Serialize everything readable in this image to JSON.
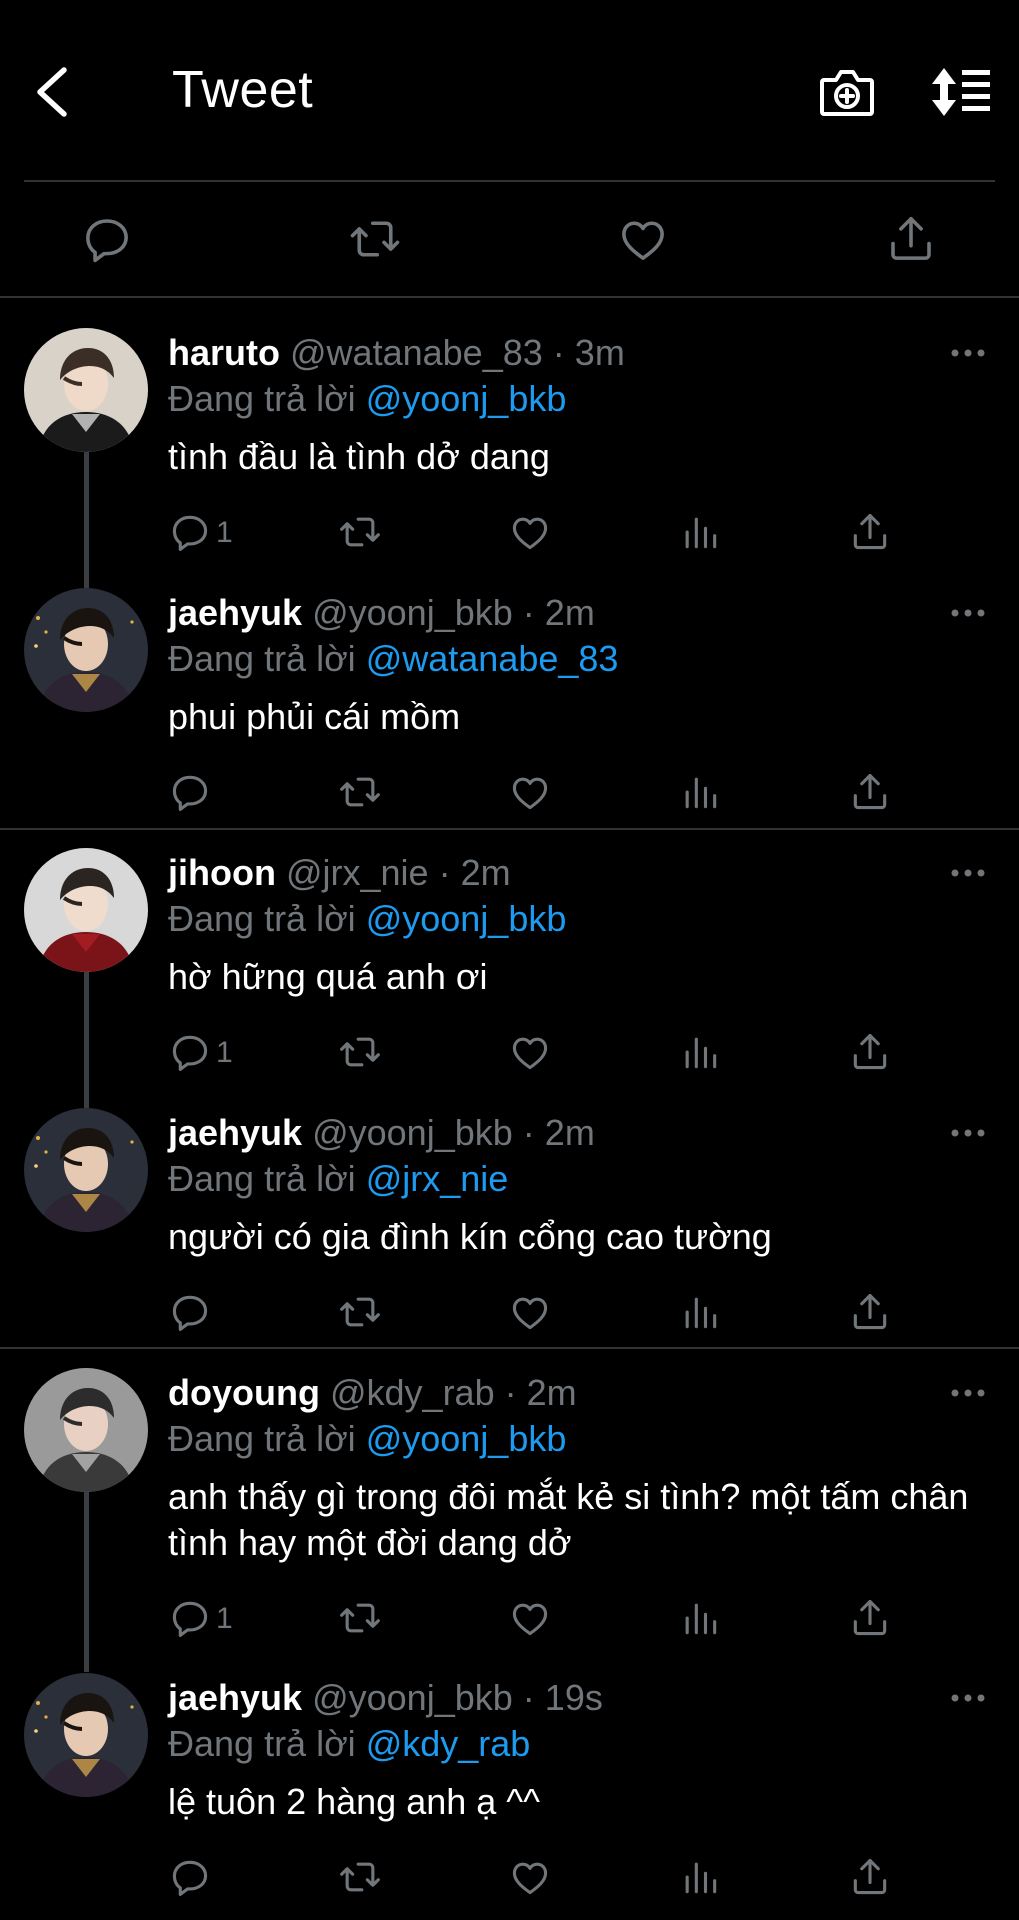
{
  "header": {
    "title": "Tweet",
    "back_icon": "back-chevron-icon",
    "camera_icon": "camera-plus-icon",
    "sort_icon": "sort-list-icon"
  },
  "main_actions": {
    "icons": [
      "reply-icon",
      "retweet-icon",
      "like-icon",
      "share-icon"
    ]
  },
  "colors": {
    "background": "#000000",
    "text": "#ffffff",
    "muted": "#71767b",
    "accent": "#1d9bf0",
    "divider": "#2f3336"
  },
  "replies": [
    {
      "name": "haruto",
      "handle": "@watanabe_83",
      "time": "3m",
      "replying_prefix": "Đang trả lời",
      "replying_to": "@yoonj_bkb",
      "text": "tình đầu là tình dở dang",
      "reply_count": "1",
      "avatar_desc": "avatar-haruto"
    },
    {
      "name": "jaehyuk",
      "handle": "@yoonj_bkb",
      "time": "2m",
      "replying_prefix": "Đang trả lời",
      "replying_to": "@watanabe_83",
      "text": "phui phủi cái mồm",
      "reply_count": "",
      "avatar_desc": "avatar-jaehyuk"
    },
    {
      "name": "jihoon",
      "handle": "@jrx_nie",
      "time": "2m",
      "replying_prefix": "Đang trả lời",
      "replying_to": "@yoonj_bkb",
      "text": "hờ hững quá anh ơi",
      "reply_count": "1",
      "avatar_desc": "avatar-jihoon"
    },
    {
      "name": "jaehyuk",
      "handle": "@yoonj_bkb",
      "time": "2m",
      "replying_prefix": "Đang trả lời",
      "replying_to": "@jrx_nie",
      "text": "người có gia đình kín cổng cao tường",
      "reply_count": "",
      "avatar_desc": "avatar-jaehyuk"
    },
    {
      "name": "doyoung",
      "handle": "@kdy_rab",
      "time": "2m",
      "replying_prefix": "Đang trả lời",
      "replying_to": "@yoonj_bkb",
      "text": "anh thấy gì trong đôi mắt kẻ si tình? một tấm chân tình hay một đời dang dở",
      "reply_count": "1",
      "avatar_desc": "avatar-doyoung"
    },
    {
      "name": "jaehyuk",
      "handle": "@yoonj_bkb",
      "time": "19s",
      "replying_prefix": "Đang trả lời",
      "replying_to": "@kdy_rab",
      "text": "lệ tuôn 2 hàng anh ạ ^^",
      "reply_count": "",
      "avatar_desc": "avatar-jaehyuk"
    }
  ]
}
